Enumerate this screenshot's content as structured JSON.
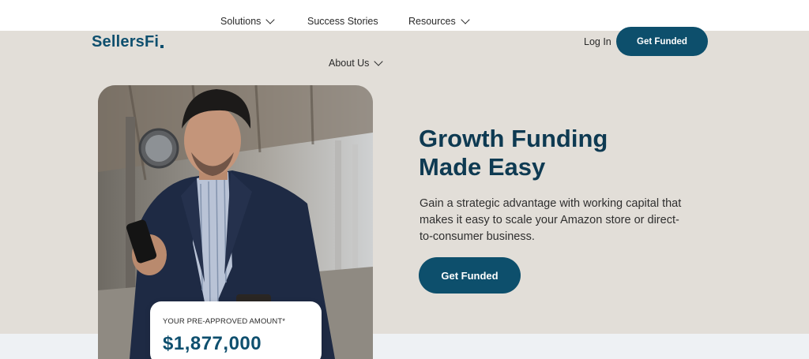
{
  "nav": {
    "items": [
      {
        "label": "Solutions",
        "has_dropdown": true
      },
      {
        "label": "Success Stories",
        "has_dropdown": false
      },
      {
        "label": "Resources",
        "has_dropdown": true
      },
      {
        "label": "About Us",
        "has_dropdown": true
      }
    ],
    "login_label": "Log In",
    "cta_label": "Get Funded"
  },
  "brand": {
    "logo_text": "SellersFi",
    "color": "#0e4f6e"
  },
  "hero": {
    "headline_line1": "Growth Funding",
    "headline_line2": "Made Easy",
    "subtext": "Gain a strategic advantage with working capital that makes it easy to scale your Amazon store or direct-to-consumer business.",
    "cta_label": "Get Funded",
    "background": "#e2ded8"
  },
  "preapproval_card": {
    "label": "YOUR PRE-APPROVED AMOUNT*",
    "amount": "$1,877,000"
  },
  "colors": {
    "button": "#0d4f6c",
    "headline": "#0e3a52"
  },
  "image": {
    "description_icon": "photo-man-with-phone"
  }
}
